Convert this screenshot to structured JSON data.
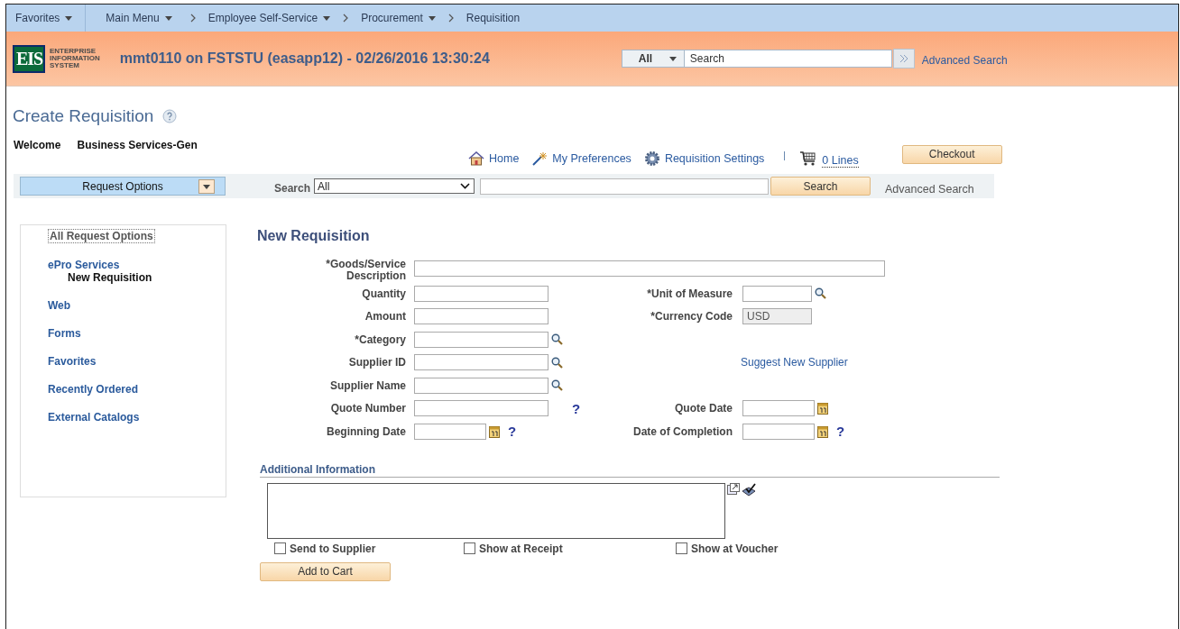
{
  "nav": [
    {
      "label": "Favorites",
      "dropdown": true
    },
    {
      "label": "Main Menu",
      "dropdown": true
    },
    {
      "label": "Employee Self-Service",
      "dropdown": true
    },
    {
      "label": "Procurement",
      "dropdown": true
    },
    {
      "label": "Requisition",
      "dropdown": false
    }
  ],
  "header": {
    "logo_mark": "EIS",
    "logo_lines": [
      "ENTERPRISE",
      "INFORMATION",
      "SYSTEM"
    ],
    "title": "mmt0110 on FSTSTU (easapp12) - 02/26/2016 13:30:24",
    "search_scope": "All",
    "search_placeholder": "Search",
    "advanced_link": "Advanced Search"
  },
  "page": {
    "title": "Create Requisition",
    "welcome_label": "Welcome",
    "welcome_name": "Business Services-Gen"
  },
  "links": [
    {
      "kind": "home",
      "label": "Home"
    },
    {
      "kind": "preferences",
      "label": "My Preferences"
    },
    {
      "kind": "settings",
      "label": "Requisition Settings"
    },
    {
      "kind": "cart",
      "label": "0 Lines"
    }
  ],
  "checkout_button": "Checkout",
  "search_bar": {
    "request_options": "Request Options",
    "search_label": "Search",
    "scope": "All",
    "button": "Search",
    "advanced": "Advanced Search"
  },
  "sidebar": {
    "header": "All Request Options",
    "items": [
      {
        "label": "ePro Services",
        "selected": false,
        "children": [
          {
            "label": "New Requisition",
            "selected": true
          }
        ]
      },
      {
        "label": "Web",
        "selected": false
      },
      {
        "label": "Forms",
        "selected": false
      },
      {
        "label": "Favorites",
        "selected": false
      },
      {
        "label": "Recently Ordered",
        "selected": false
      },
      {
        "label": "External Catalogs",
        "selected": false
      }
    ]
  },
  "form": {
    "title": "New Requisition",
    "rows": [
      {
        "left": {
          "label": "*Goods/Service Description",
          "kind": "wide"
        }
      },
      {
        "left": {
          "label": "Quantity",
          "kind": "text"
        },
        "right": {
          "label": "*Unit of Measure",
          "kind": "lookup"
        }
      },
      {
        "left": {
          "label": "Amount",
          "kind": "text"
        },
        "right": {
          "label": "*Currency Code",
          "kind": "readonly",
          "value": "USD"
        }
      },
      {
        "left": {
          "label": "*Category",
          "kind": "lookup"
        }
      },
      {
        "left": {
          "label": "Supplier ID",
          "kind": "lookup"
        },
        "right": {
          "label": "Suggest New Supplier",
          "kind": "link"
        }
      },
      {
        "left": {
          "label": "Supplier Name",
          "kind": "lookup"
        }
      },
      {
        "left": {
          "label": "Quote Number",
          "kind": "text",
          "help": "?"
        },
        "right": {
          "label": "Quote Date",
          "kind": "date"
        }
      },
      {
        "left": {
          "label": "Beginning Date",
          "kind": "date",
          "help": "?"
        },
        "right": {
          "label": "Date of Completion",
          "kind": "date",
          "help": "?"
        }
      }
    ],
    "additional_heading": "Additional Information",
    "checkboxes": [
      {
        "label": "Send to Supplier",
        "checked": false
      },
      {
        "label": "Show at Receipt",
        "checked": false
      },
      {
        "label": "Show at Voucher",
        "checked": false
      }
    ],
    "add_button": "Add to Cart"
  }
}
